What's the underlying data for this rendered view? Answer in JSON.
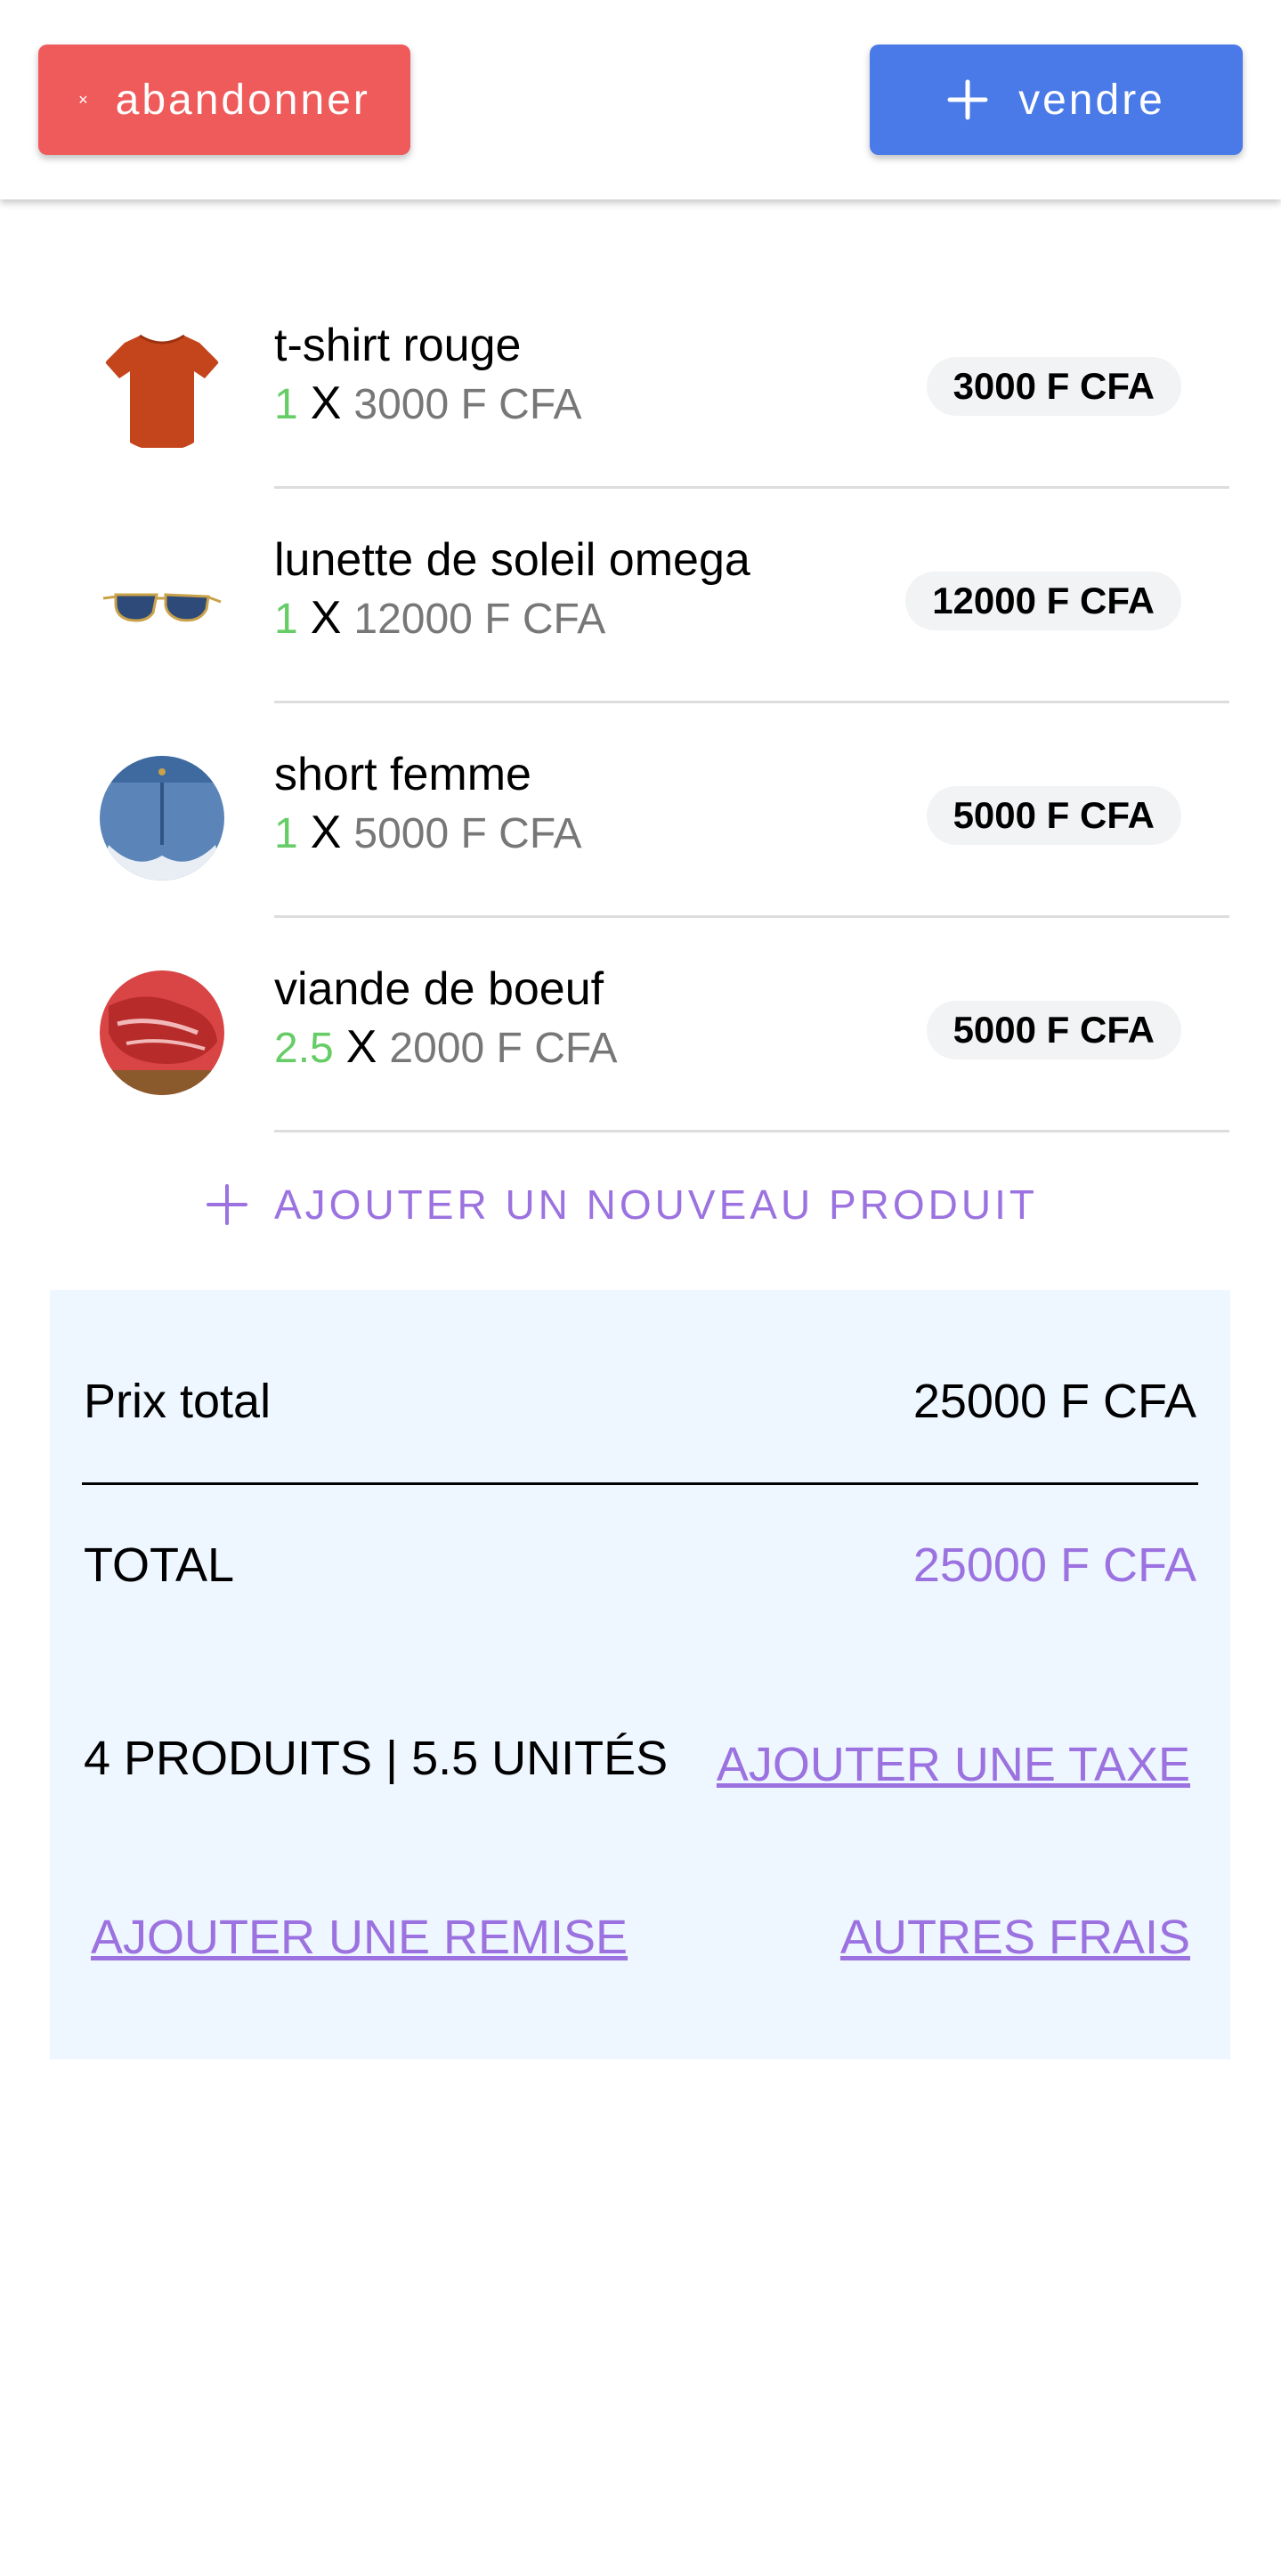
{
  "header": {
    "cancel_icon": "×",
    "cancel_label": "abandonner",
    "sell_icon": "plus-icon",
    "sell_label": "vendre"
  },
  "cart": {
    "items": [
      {
        "name": "t-shirt rouge",
        "qty": "1",
        "x": "X",
        "unit_price": "3000 F CFA",
        "total": "3000 F CFA",
        "image": "red-tshirt"
      },
      {
        "name": "lunette de soleil omega",
        "qty": "1",
        "x": "X",
        "unit_price": "12000 F CFA",
        "total": "12000 F CFA",
        "image": "sunglasses"
      },
      {
        "name": "short femme",
        "qty": "1",
        "x": "X",
        "unit_price": "5000 F CFA",
        "total": "5000 F CFA",
        "image": "denim-shorts"
      },
      {
        "name": "viande de boeuf",
        "qty": "2.5",
        "x": "X",
        "unit_price": "2000 F CFA",
        "total": "5000 F CFA",
        "image": "beef-meat"
      }
    ],
    "add_product_label": "AJOUTER UN NOUVEAU PRODUIT"
  },
  "summary": {
    "subtotal_label": "Prix total",
    "subtotal_value": "25000 F CFA",
    "total_label": "TOTAL",
    "total_value": "25000 F CFA",
    "counts_label": "4 PRODUITS | 5.5 UNITÉS",
    "add_tax_label": "AJOUTER UNE TAXE",
    "add_discount_label": "AJOUTER UNE REMISE",
    "other_fees_label": "AUTRES FRAIS"
  },
  "colors": {
    "cancel": "#ef5b5b",
    "sell": "#4a7ae8",
    "accent": "#9b72e0",
    "qty": "#66cc66",
    "summary_bg": "#eef6ff"
  }
}
